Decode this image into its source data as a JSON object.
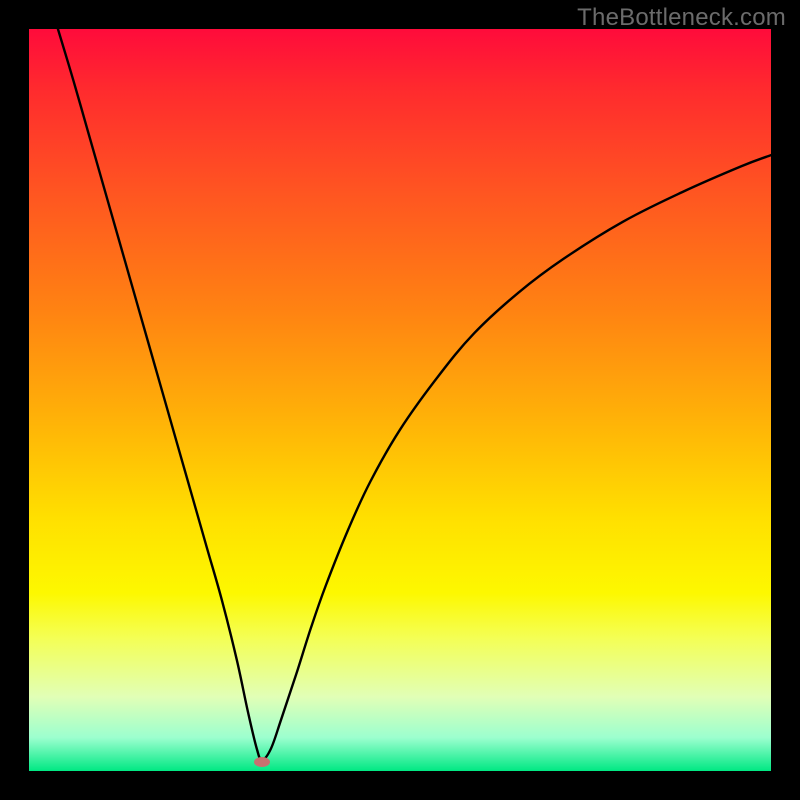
{
  "watermark": "TheBottleneck.com",
  "chart_data": {
    "type": "line",
    "title": "",
    "xlabel": "",
    "ylabel": "",
    "xlim": [
      0,
      100
    ],
    "ylim": [
      0,
      100
    ],
    "grid": false,
    "series": [
      {
        "name": "curve",
        "x": [
          3.9,
          6,
          8,
          10,
          12,
          14,
          16,
          18,
          20,
          22,
          24,
          26,
          28,
          29.5,
          30.7,
          31.4,
          32.6,
          34,
          36,
          38,
          40,
          43,
          46,
          50,
          55,
          60,
          66,
          72,
          80,
          88,
          96,
          100
        ],
        "values": [
          100,
          93,
          86,
          79,
          72,
          65,
          58,
          51,
          44,
          37,
          30,
          23,
          15,
          8,
          3,
          1.5,
          3,
          7,
          13,
          19.3,
          25,
          32.5,
          39,
          46,
          53,
          59,
          64.5,
          69,
          74,
          78,
          81.5,
          83
        ]
      }
    ],
    "minimum_marker": {
      "x": 31.4,
      "y": 1.2
    },
    "background_gradient": {
      "top": "#ff0b3b",
      "middle": "#ffe000",
      "bottom": "#00e883"
    }
  }
}
